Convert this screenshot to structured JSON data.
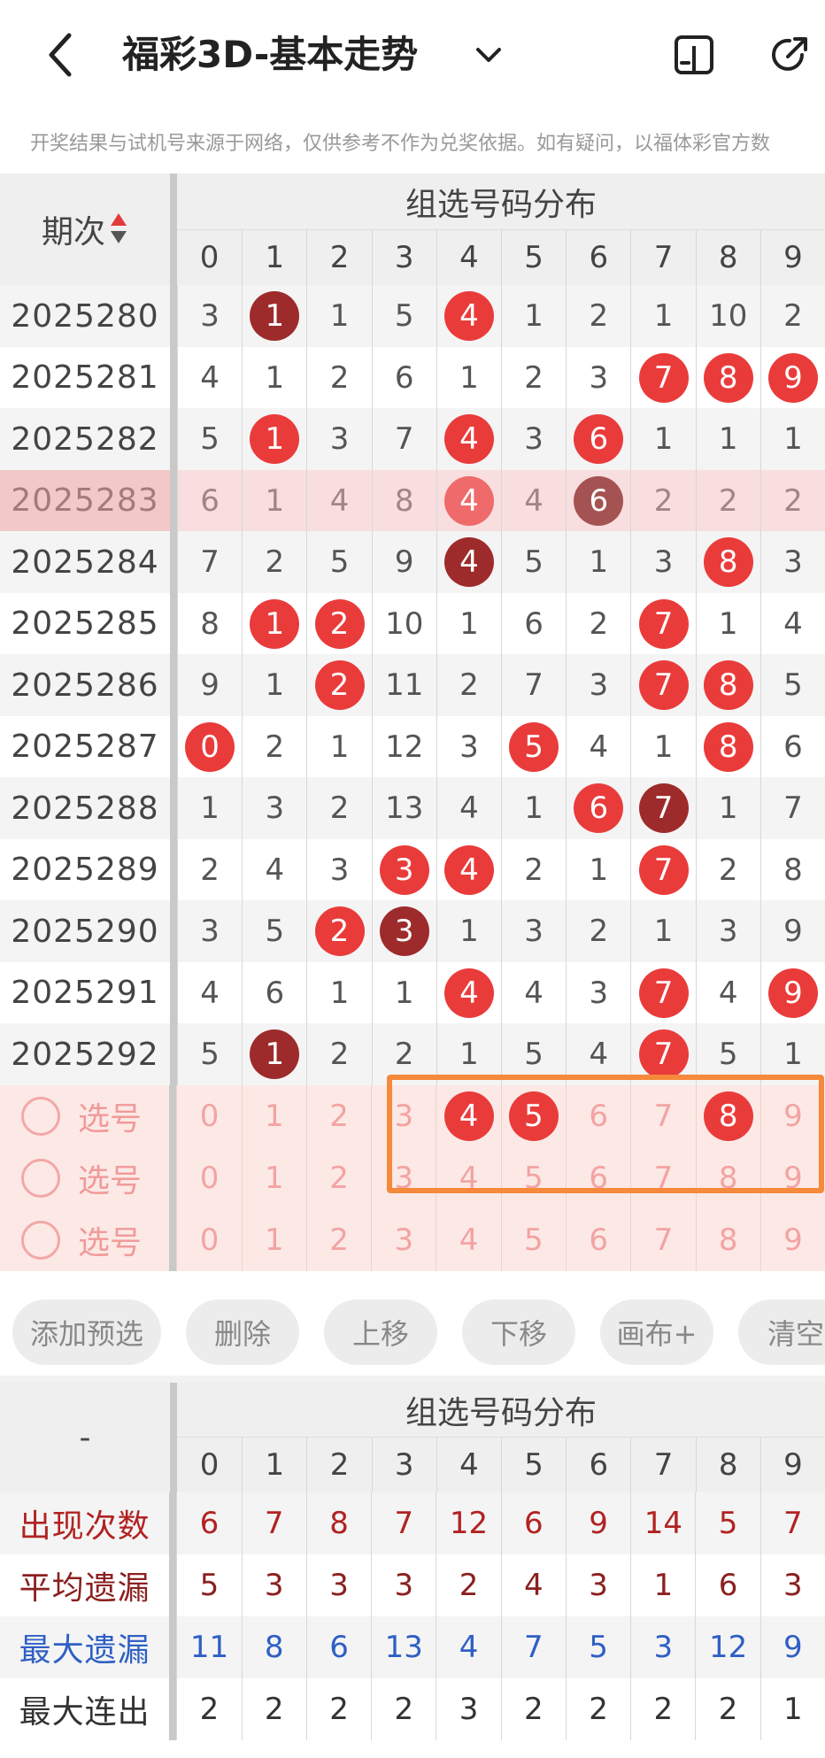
{
  "header": {
    "title": "福彩3D-基本走势",
    "disclaimer": "开奖结果与试机号来源于网络，仅供参考不作为兑奖依据。如有疑问，以福体彩官方数"
  },
  "table": {
    "period_header": "期次",
    "group_title": "组选号码分布",
    "digits": [
      "0",
      "1",
      "2",
      "3",
      "4",
      "5",
      "6",
      "7",
      "8",
      "9"
    ],
    "rows": [
      {
        "period": "2025280",
        "cells": [
          {
            "v": "3"
          },
          {
            "v": "1",
            "b": "dark"
          },
          {
            "v": "1"
          },
          {
            "v": "5"
          },
          {
            "v": "4",
            "b": "red"
          },
          {
            "v": "1"
          },
          {
            "v": "2"
          },
          {
            "v": "1"
          },
          {
            "v": "10"
          },
          {
            "v": "2"
          }
        ]
      },
      {
        "period": "2025281",
        "cells": [
          {
            "v": "4"
          },
          {
            "v": "1"
          },
          {
            "v": "2"
          },
          {
            "v": "6"
          },
          {
            "v": "1"
          },
          {
            "v": "2"
          },
          {
            "v": "3"
          },
          {
            "v": "7",
            "b": "red"
          },
          {
            "v": "8",
            "b": "red"
          },
          {
            "v": "9",
            "b": "red"
          }
        ]
      },
      {
        "period": "2025282",
        "cells": [
          {
            "v": "5"
          },
          {
            "v": "1",
            "b": "red"
          },
          {
            "v": "3"
          },
          {
            "v": "7"
          },
          {
            "v": "4",
            "b": "red"
          },
          {
            "v": "3"
          },
          {
            "v": "6",
            "b": "red"
          },
          {
            "v": "1"
          },
          {
            "v": "1"
          },
          {
            "v": "1"
          }
        ]
      },
      {
        "period": "2025283",
        "hl": true,
        "cells": [
          {
            "v": "6"
          },
          {
            "v": "1"
          },
          {
            "v": "4"
          },
          {
            "v": "8"
          },
          {
            "v": "4",
            "b": "pink"
          },
          {
            "v": "4"
          },
          {
            "v": "6",
            "b": "grey"
          },
          {
            "v": "2"
          },
          {
            "v": "2"
          },
          {
            "v": "2"
          }
        ]
      },
      {
        "period": "2025284",
        "cells": [
          {
            "v": "7"
          },
          {
            "v": "2"
          },
          {
            "v": "5"
          },
          {
            "v": "9"
          },
          {
            "v": "4",
            "b": "dark"
          },
          {
            "v": "5"
          },
          {
            "v": "1"
          },
          {
            "v": "3"
          },
          {
            "v": "8",
            "b": "red"
          },
          {
            "v": "3"
          }
        ]
      },
      {
        "period": "2025285",
        "cells": [
          {
            "v": "8"
          },
          {
            "v": "1",
            "b": "red"
          },
          {
            "v": "2",
            "b": "red"
          },
          {
            "v": "10"
          },
          {
            "v": "1"
          },
          {
            "v": "6"
          },
          {
            "v": "2"
          },
          {
            "v": "7",
            "b": "red"
          },
          {
            "v": "1"
          },
          {
            "v": "4"
          }
        ]
      },
      {
        "period": "2025286",
        "cells": [
          {
            "v": "9"
          },
          {
            "v": "1"
          },
          {
            "v": "2",
            "b": "red"
          },
          {
            "v": "11"
          },
          {
            "v": "2"
          },
          {
            "v": "7"
          },
          {
            "v": "3"
          },
          {
            "v": "7",
            "b": "red"
          },
          {
            "v": "8",
            "b": "red"
          },
          {
            "v": "5"
          }
        ]
      },
      {
        "period": "2025287",
        "cells": [
          {
            "v": "0",
            "b": "red"
          },
          {
            "v": "2"
          },
          {
            "v": "1"
          },
          {
            "v": "12"
          },
          {
            "v": "3"
          },
          {
            "v": "5",
            "b": "red"
          },
          {
            "v": "4"
          },
          {
            "v": "1"
          },
          {
            "v": "8",
            "b": "red"
          },
          {
            "v": "6"
          }
        ]
      },
      {
        "period": "2025288",
        "cells": [
          {
            "v": "1"
          },
          {
            "v": "3"
          },
          {
            "v": "2"
          },
          {
            "v": "13"
          },
          {
            "v": "4"
          },
          {
            "v": "1"
          },
          {
            "v": "6",
            "b": "red"
          },
          {
            "v": "7",
            "b": "dark"
          },
          {
            "v": "1"
          },
          {
            "v": "7"
          }
        ]
      },
      {
        "period": "2025289",
        "cells": [
          {
            "v": "2"
          },
          {
            "v": "4"
          },
          {
            "v": "3"
          },
          {
            "v": "3",
            "b": "red"
          },
          {
            "v": "4",
            "b": "red"
          },
          {
            "v": "2"
          },
          {
            "v": "1"
          },
          {
            "v": "7",
            "b": "red"
          },
          {
            "v": "2"
          },
          {
            "v": "8"
          }
        ]
      },
      {
        "period": "2025290",
        "cells": [
          {
            "v": "3"
          },
          {
            "v": "5"
          },
          {
            "v": "2",
            "b": "red"
          },
          {
            "v": "3",
            "b": "dark"
          },
          {
            "v": "1"
          },
          {
            "v": "3"
          },
          {
            "v": "2"
          },
          {
            "v": "1"
          },
          {
            "v": "3"
          },
          {
            "v": "9"
          }
        ]
      },
      {
        "period": "2025291",
        "cells": [
          {
            "v": "4"
          },
          {
            "v": "6"
          },
          {
            "v": "1"
          },
          {
            "v": "1"
          },
          {
            "v": "4",
            "b": "red"
          },
          {
            "v": "4"
          },
          {
            "v": "3"
          },
          {
            "v": "7",
            "b": "red"
          },
          {
            "v": "4"
          },
          {
            "v": "9",
            "b": "red"
          }
        ]
      },
      {
        "period": "2025292",
        "cells": [
          {
            "v": "5"
          },
          {
            "v": "1",
            "b": "dark"
          },
          {
            "v": "2"
          },
          {
            "v": "2"
          },
          {
            "v": "1"
          },
          {
            "v": "5"
          },
          {
            "v": "4"
          },
          {
            "v": "7",
            "b": "red"
          },
          {
            "v": "5"
          },
          {
            "v": "1"
          }
        ]
      }
    ],
    "pick_label": "选号",
    "pick_rows": [
      {
        "selected": [
          "4",
          "5",
          "8"
        ]
      },
      {
        "selected": []
      },
      {
        "selected": []
      }
    ]
  },
  "actions": [
    "添加预选",
    "删除",
    "上移",
    "下移",
    "画布+",
    "清空"
  ],
  "stats": {
    "corner": "-",
    "group_title": "组选号码分布",
    "rows": [
      {
        "label": "出现次数",
        "color": "#b22222",
        "values": [
          "6",
          "7",
          "8",
          "7",
          "12",
          "6",
          "9",
          "14",
          "5",
          "7"
        ]
      },
      {
        "label": "平均遗漏",
        "color": "#8b2020",
        "values": [
          "5",
          "3",
          "3",
          "3",
          "2",
          "4",
          "3",
          "1",
          "6",
          "3"
        ]
      },
      {
        "label": "最大遗漏",
        "color": "#2f5fc4",
        "values": [
          "11",
          "8",
          "6",
          "13",
          "4",
          "7",
          "5",
          "3",
          "12",
          "9"
        ]
      },
      {
        "label": "最大连出",
        "color": "#333333",
        "values": [
          "2",
          "2",
          "2",
          "2",
          "3",
          "2",
          "2",
          "2",
          "2",
          "1"
        ]
      }
    ]
  }
}
